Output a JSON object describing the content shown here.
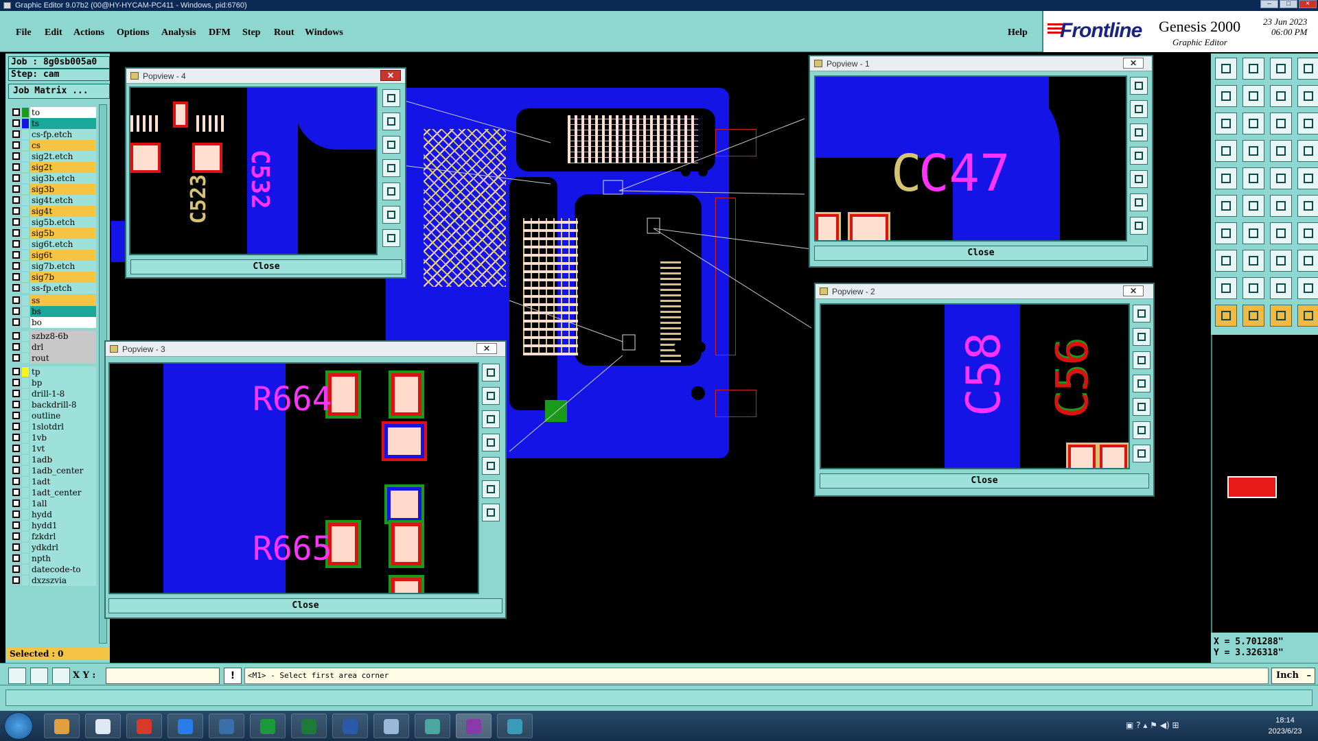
{
  "window": {
    "title": "Graphic Editor 9.07b2 (00@HY-HYCAM-PC411 - Windows, pid:6760)"
  },
  "menu": [
    "File",
    "Edit",
    "Actions",
    "Options",
    "Analysis",
    "DFM",
    "Step",
    "Rout",
    "Windows"
  ],
  "help_label": "Help",
  "brand": {
    "logo": "Frontline",
    "product": "Genesis 2000",
    "subtitle": "Graphic Editor",
    "date": "23 Jun 2023",
    "time": "06:00 PM"
  },
  "job": {
    "job_label": "Job : 8g0sb005a0",
    "step_label": "Step: cam",
    "matrix_button": "Job Matrix ..."
  },
  "layers": [
    {
      "name": "to",
      "color": "#ffffff",
      "swatch": "#1a9a1a"
    },
    {
      "name": "ts",
      "color": "#1aa89a",
      "swatch": "#1414e6"
    },
    {
      "name": "cs-fp.etch",
      "color": "#9ee0da",
      "swatch": "#9ee0da"
    },
    {
      "name": "cs",
      "color": "#f6c445",
      "swatch": "#9ee0da"
    },
    {
      "name": "sig2t.etch",
      "color": "#9ee0da",
      "swatch": "#9ee0da"
    },
    {
      "name": "sig2t",
      "color": "#f6c445",
      "swatch": "#9ee0da"
    },
    {
      "name": "sig3b.etch",
      "color": "#9ee0da",
      "swatch": "#9ee0da"
    },
    {
      "name": "sig3b",
      "color": "#f6c445",
      "swatch": "#9ee0da"
    },
    {
      "name": "sig4t.etch",
      "color": "#9ee0da",
      "swatch": "#9ee0da"
    },
    {
      "name": "sig4t",
      "color": "#f6c445",
      "swatch": "#9ee0da"
    },
    {
      "name": "sig5b.etch",
      "color": "#9ee0da",
      "swatch": "#9ee0da"
    },
    {
      "name": "sig5b",
      "color": "#f6c445",
      "swatch": "#9ee0da"
    },
    {
      "name": "sig6t.etch",
      "color": "#9ee0da",
      "swatch": "#9ee0da"
    },
    {
      "name": "sig6t",
      "color": "#f6c445",
      "swatch": "#9ee0da"
    },
    {
      "name": "sig7b.etch",
      "color": "#9ee0da",
      "swatch": "#9ee0da"
    },
    {
      "name": "sig7b",
      "color": "#f6c445",
      "swatch": "#9ee0da"
    },
    {
      "name": "ss-fp.etch",
      "color": "#9ee0da",
      "swatch": "#9ee0da"
    },
    {
      "name": "ss",
      "color": "#f6c445",
      "swatch": "#9ee0da"
    },
    {
      "name": "bs",
      "color": "#1aa89a",
      "swatch": "#9ee0da"
    },
    {
      "name": "bo",
      "color": "#ffffff",
      "swatch": "#9ee0da"
    },
    {
      "name": "szbz8-6b",
      "color": "#c8c8c8",
      "swatch": "#9ee0da"
    },
    {
      "name": "drl",
      "color": "#c8c8c8",
      "swatch": "#9ee0da"
    },
    {
      "name": "rout",
      "color": "#c8c8c8",
      "swatch": "#9ee0da"
    },
    {
      "name": "tp",
      "color": "#9ee0da",
      "swatch": "#f6f61a"
    },
    {
      "name": "bp",
      "color": "#9ee0da",
      "swatch": "#9ee0da"
    },
    {
      "name": "drill-1-8",
      "color": "#9ee0da",
      "swatch": "#9ee0da"
    },
    {
      "name": "backdrill-8",
      "color": "#9ee0da",
      "swatch": "#9ee0da"
    },
    {
      "name": "outline",
      "color": "#9ee0da",
      "swatch": "#9ee0da"
    },
    {
      "name": "1slotdrl",
      "color": "#9ee0da",
      "swatch": "#9ee0da"
    },
    {
      "name": "1vb",
      "color": "#9ee0da",
      "swatch": "#9ee0da"
    },
    {
      "name": "1vt",
      "color": "#9ee0da",
      "swatch": "#9ee0da"
    },
    {
      "name": "1adb",
      "color": "#9ee0da",
      "swatch": "#9ee0da"
    },
    {
      "name": "1adb_center",
      "color": "#9ee0da",
      "swatch": "#9ee0da"
    },
    {
      "name": "1adt",
      "color": "#9ee0da",
      "swatch": "#9ee0da"
    },
    {
      "name": "1adt_center",
      "color": "#9ee0da",
      "swatch": "#9ee0da"
    },
    {
      "name": "1all",
      "color": "#9ee0da",
      "swatch": "#9ee0da"
    },
    {
      "name": "hydd",
      "color": "#9ee0da",
      "swatch": "#9ee0da"
    },
    {
      "name": "hydd1",
      "color": "#9ee0da",
      "swatch": "#9ee0da"
    },
    {
      "name": "fzkdrl",
      "color": "#9ee0da",
      "swatch": "#9ee0da"
    },
    {
      "name": "ydkdrl",
      "color": "#9ee0da",
      "swatch": "#9ee0da"
    },
    {
      "name": "npth",
      "color": "#9ee0da",
      "swatch": "#9ee0da"
    },
    {
      "name": "datecode-to",
      "color": "#9ee0da",
      "swatch": "#9ee0da"
    },
    {
      "name": "dxzszvia",
      "color": "#9ee0da",
      "swatch": "#9ee0da"
    }
  ],
  "selected_label": "Selected : 0",
  "popviews": [
    {
      "title": "Popview - 4",
      "close": "Close",
      "labels": [
        "C532",
        "C523"
      ]
    },
    {
      "title": "Popview - 1",
      "close": "Close",
      "labels": [
        "C47"
      ]
    },
    {
      "title": "Popview - 2",
      "close": "Close",
      "labels": [
        "C58",
        "C56"
      ]
    },
    {
      "title": "Popview - 3",
      "close": "Close",
      "labels": [
        "R664",
        "R665"
      ]
    }
  ],
  "coords": {
    "x": "X = 5.701288\"",
    "y": "Y = 3.326318\""
  },
  "command": {
    "xy_label": "X Y :",
    "xy_value": "",
    "bang": "!",
    "prompt": "<M1> - Select first area corner",
    "units": "Inch"
  },
  "taskbar": {
    "time": "18:14",
    "date": "2023/6/23"
  }
}
